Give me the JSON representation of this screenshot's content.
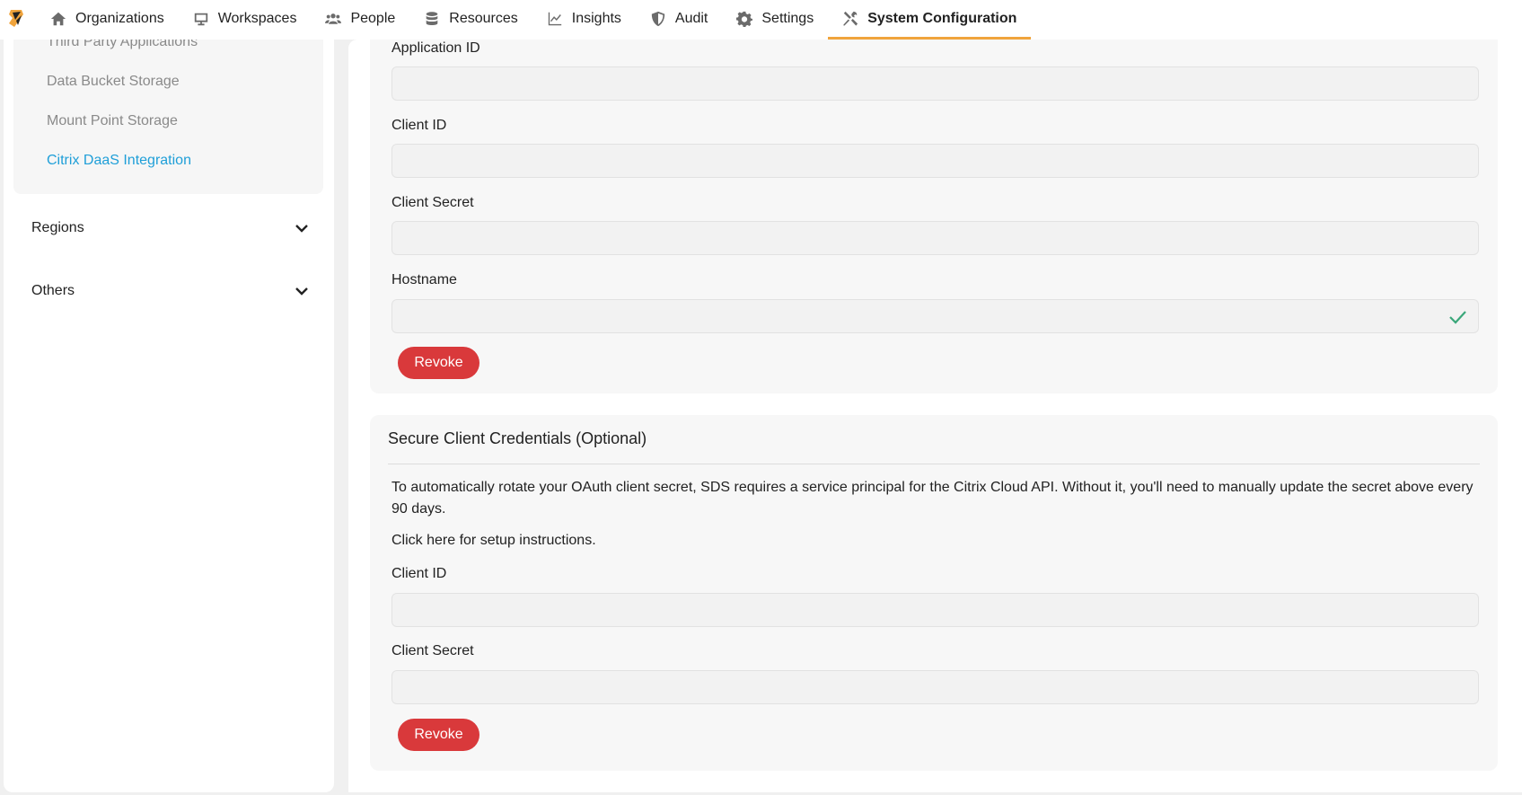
{
  "nav": {
    "items": [
      {
        "label": "Organizations",
        "icon": "home-icon"
      },
      {
        "label": "Workspaces",
        "icon": "monitor-icon"
      },
      {
        "label": "People",
        "icon": "people-icon"
      },
      {
        "label": "Resources",
        "icon": "database-icon"
      },
      {
        "label": "Insights",
        "icon": "chart-line-icon"
      },
      {
        "label": "Audit",
        "icon": "shield-icon"
      },
      {
        "label": "Settings",
        "icon": "gear-icon"
      },
      {
        "label": "System Configuration",
        "icon": "tools-icon"
      }
    ],
    "active_index": 7,
    "accent_color": "#f0a43c"
  },
  "sidebar": {
    "sub_items": [
      {
        "label": "Third Party Applications"
      },
      {
        "label": "Data Bucket Storage"
      },
      {
        "label": "Mount Point Storage"
      },
      {
        "label": "Citrix DaaS Integration",
        "active": true
      }
    ],
    "sections": [
      {
        "label": "Regions"
      },
      {
        "label": "Others"
      }
    ],
    "active_color": "#1f9fd8"
  },
  "integration_card": {
    "fields": [
      {
        "label": "Application ID",
        "value": ""
      },
      {
        "label": "Client ID",
        "value": ""
      },
      {
        "label": "Client Secret",
        "value": ""
      },
      {
        "label": "Hostname",
        "value": "",
        "validated": true
      }
    ],
    "revoke_label": "Revoke"
  },
  "secure_card": {
    "title": "Secure Client Credentials (Optional)",
    "description": "To automatically rotate your OAuth client secret, SDS requires a service principal for the Citrix Cloud API. Without it, you'll need to manually update the secret above every 90 days.",
    "setup_link": "Click here for setup instructions.",
    "fields": [
      {
        "label": "Client ID",
        "value": ""
      },
      {
        "label": "Client Secret",
        "value": ""
      }
    ],
    "revoke_label": "Revoke"
  },
  "colors": {
    "revoke": "#d9393b",
    "check": "#3aa77a"
  }
}
